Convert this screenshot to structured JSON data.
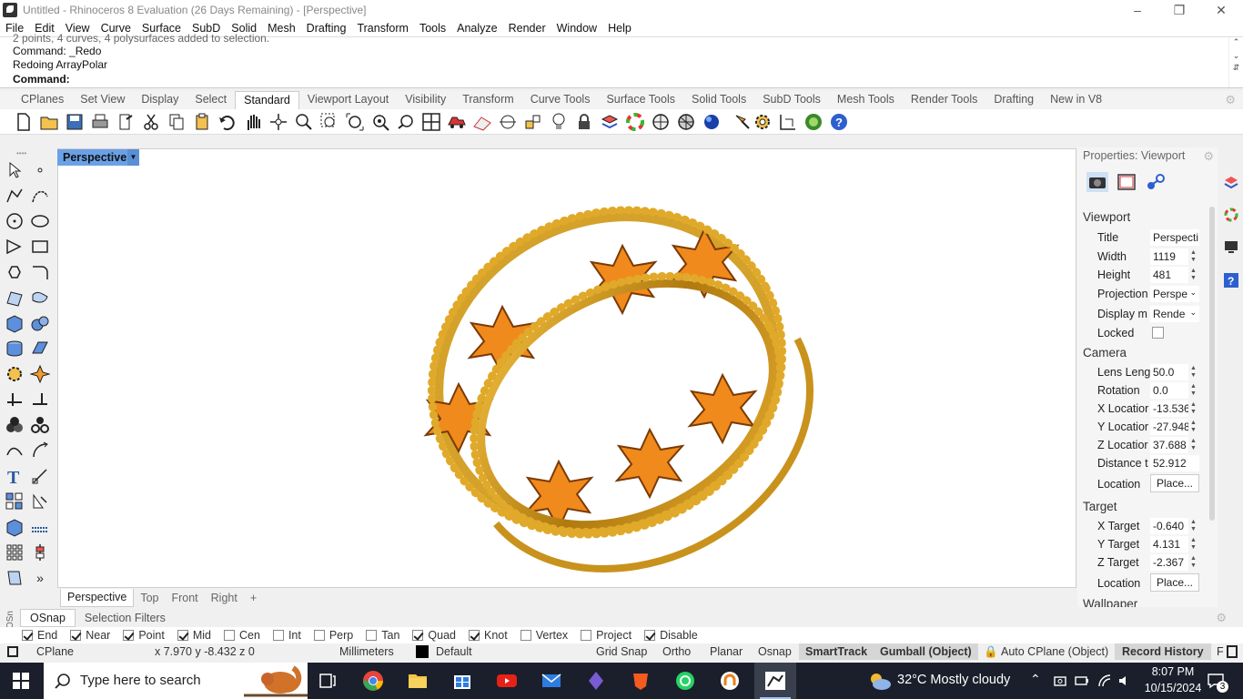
{
  "window": {
    "title": "Untitled - Rhinoceros 8 Evaluation (26 Days Remaining) - [Perspective]"
  },
  "menu": [
    "File",
    "Edit",
    "View",
    "Curve",
    "Surface",
    "SubD",
    "Solid",
    "Mesh",
    "Drafting",
    "Transform",
    "Tools",
    "Analyze",
    "Render",
    "Window",
    "Help"
  ],
  "command_history": [
    "2 points, 4 curves, 4 polysurfaces added to selection.",
    "Command: _Redo",
    "Redoing ArrayPolar"
  ],
  "command_prompt": "Command:",
  "toolbar_tabs": [
    "CPlanes",
    "Set View",
    "Display",
    "Select",
    "Standard",
    "Viewport Layout",
    "Visibility",
    "Transform",
    "Curve Tools",
    "Surface Tools",
    "Solid Tools",
    "SubD Tools",
    "Mesh Tools",
    "Render Tools",
    "Drafting",
    "New in V8"
  ],
  "active_toolbar_tab": "Standard",
  "viewport": {
    "title": "Perspective",
    "tabs": [
      "Perspective",
      "Top",
      "Front",
      "Right"
    ],
    "add_tab": "+"
  },
  "properties": {
    "header": "Properties: Viewport",
    "viewport_section": "Viewport",
    "title_label": "Title",
    "title_value": "Perspecti",
    "width_label": "Width",
    "width_value": "1119",
    "height_label": "Height",
    "height_value": "481",
    "projection_label": "Projection",
    "projection_value": "Perspe",
    "display_label": "Display m",
    "display_value": "Rende",
    "locked_label": "Locked",
    "camera_section": "Camera",
    "lens_label": "Lens Leng",
    "lens_value": "50.0",
    "rotation_label": "Rotation",
    "rotation_value": "0.0",
    "xloc_label": "X Locatior",
    "xloc_value": "-13.536",
    "yloc_label": "Y Locatior",
    "yloc_value": "-27.948",
    "zloc_label": "Z Locatior",
    "zloc_value": "37.688",
    "dist_label": "Distance t",
    "dist_value": "52.912",
    "camloc_label": "Location",
    "camloc_btn": "Place...",
    "target_section": "Target",
    "xt_label": "X Target",
    "xt_value": "-0.640",
    "yt_label": "Y Target",
    "yt_value": "4.131",
    "zt_label": "Z Target",
    "zt_value": "-2.367",
    "tloc_label": "Location",
    "tloc_btn": "Place...",
    "wallpaper_section": "Wallpaper"
  },
  "osnap_tabs": [
    "OSnap",
    "Selection Filters"
  ],
  "osnap": [
    {
      "label": "End",
      "on": true
    },
    {
      "label": "Near",
      "on": true
    },
    {
      "label": "Point",
      "on": true
    },
    {
      "label": "Mid",
      "on": true
    },
    {
      "label": "Cen",
      "on": false
    },
    {
      "label": "Int",
      "on": false
    },
    {
      "label": "Perp",
      "on": false
    },
    {
      "label": "Tan",
      "on": false
    },
    {
      "label": "Quad",
      "on": true
    },
    {
      "label": "Knot",
      "on": true
    },
    {
      "label": "Vertex",
      "on": false
    },
    {
      "label": "Project",
      "on": false
    },
    {
      "label": "Disable",
      "on": true
    }
  ],
  "status": {
    "cplane": "CPlane",
    "coords": "x 7.970  y -8.432  z 0",
    "units": "Millimeters",
    "layer": "Default",
    "grid_snap": "Grid Snap",
    "ortho": "Ortho",
    "planar": "Planar",
    "osnap": "Osnap",
    "smarttrack": "SmartTrack",
    "gumball": "Gumball (Object)",
    "autocplane": "Auto CPlane (Object)",
    "record_history": "Record History",
    "filter": "F"
  },
  "taskbar": {
    "search_placeholder": "Type here to search",
    "weather": "32°C  Mostly cloudy",
    "time": "8:07 PM",
    "date": "10/15/2024",
    "notifications": "3"
  }
}
